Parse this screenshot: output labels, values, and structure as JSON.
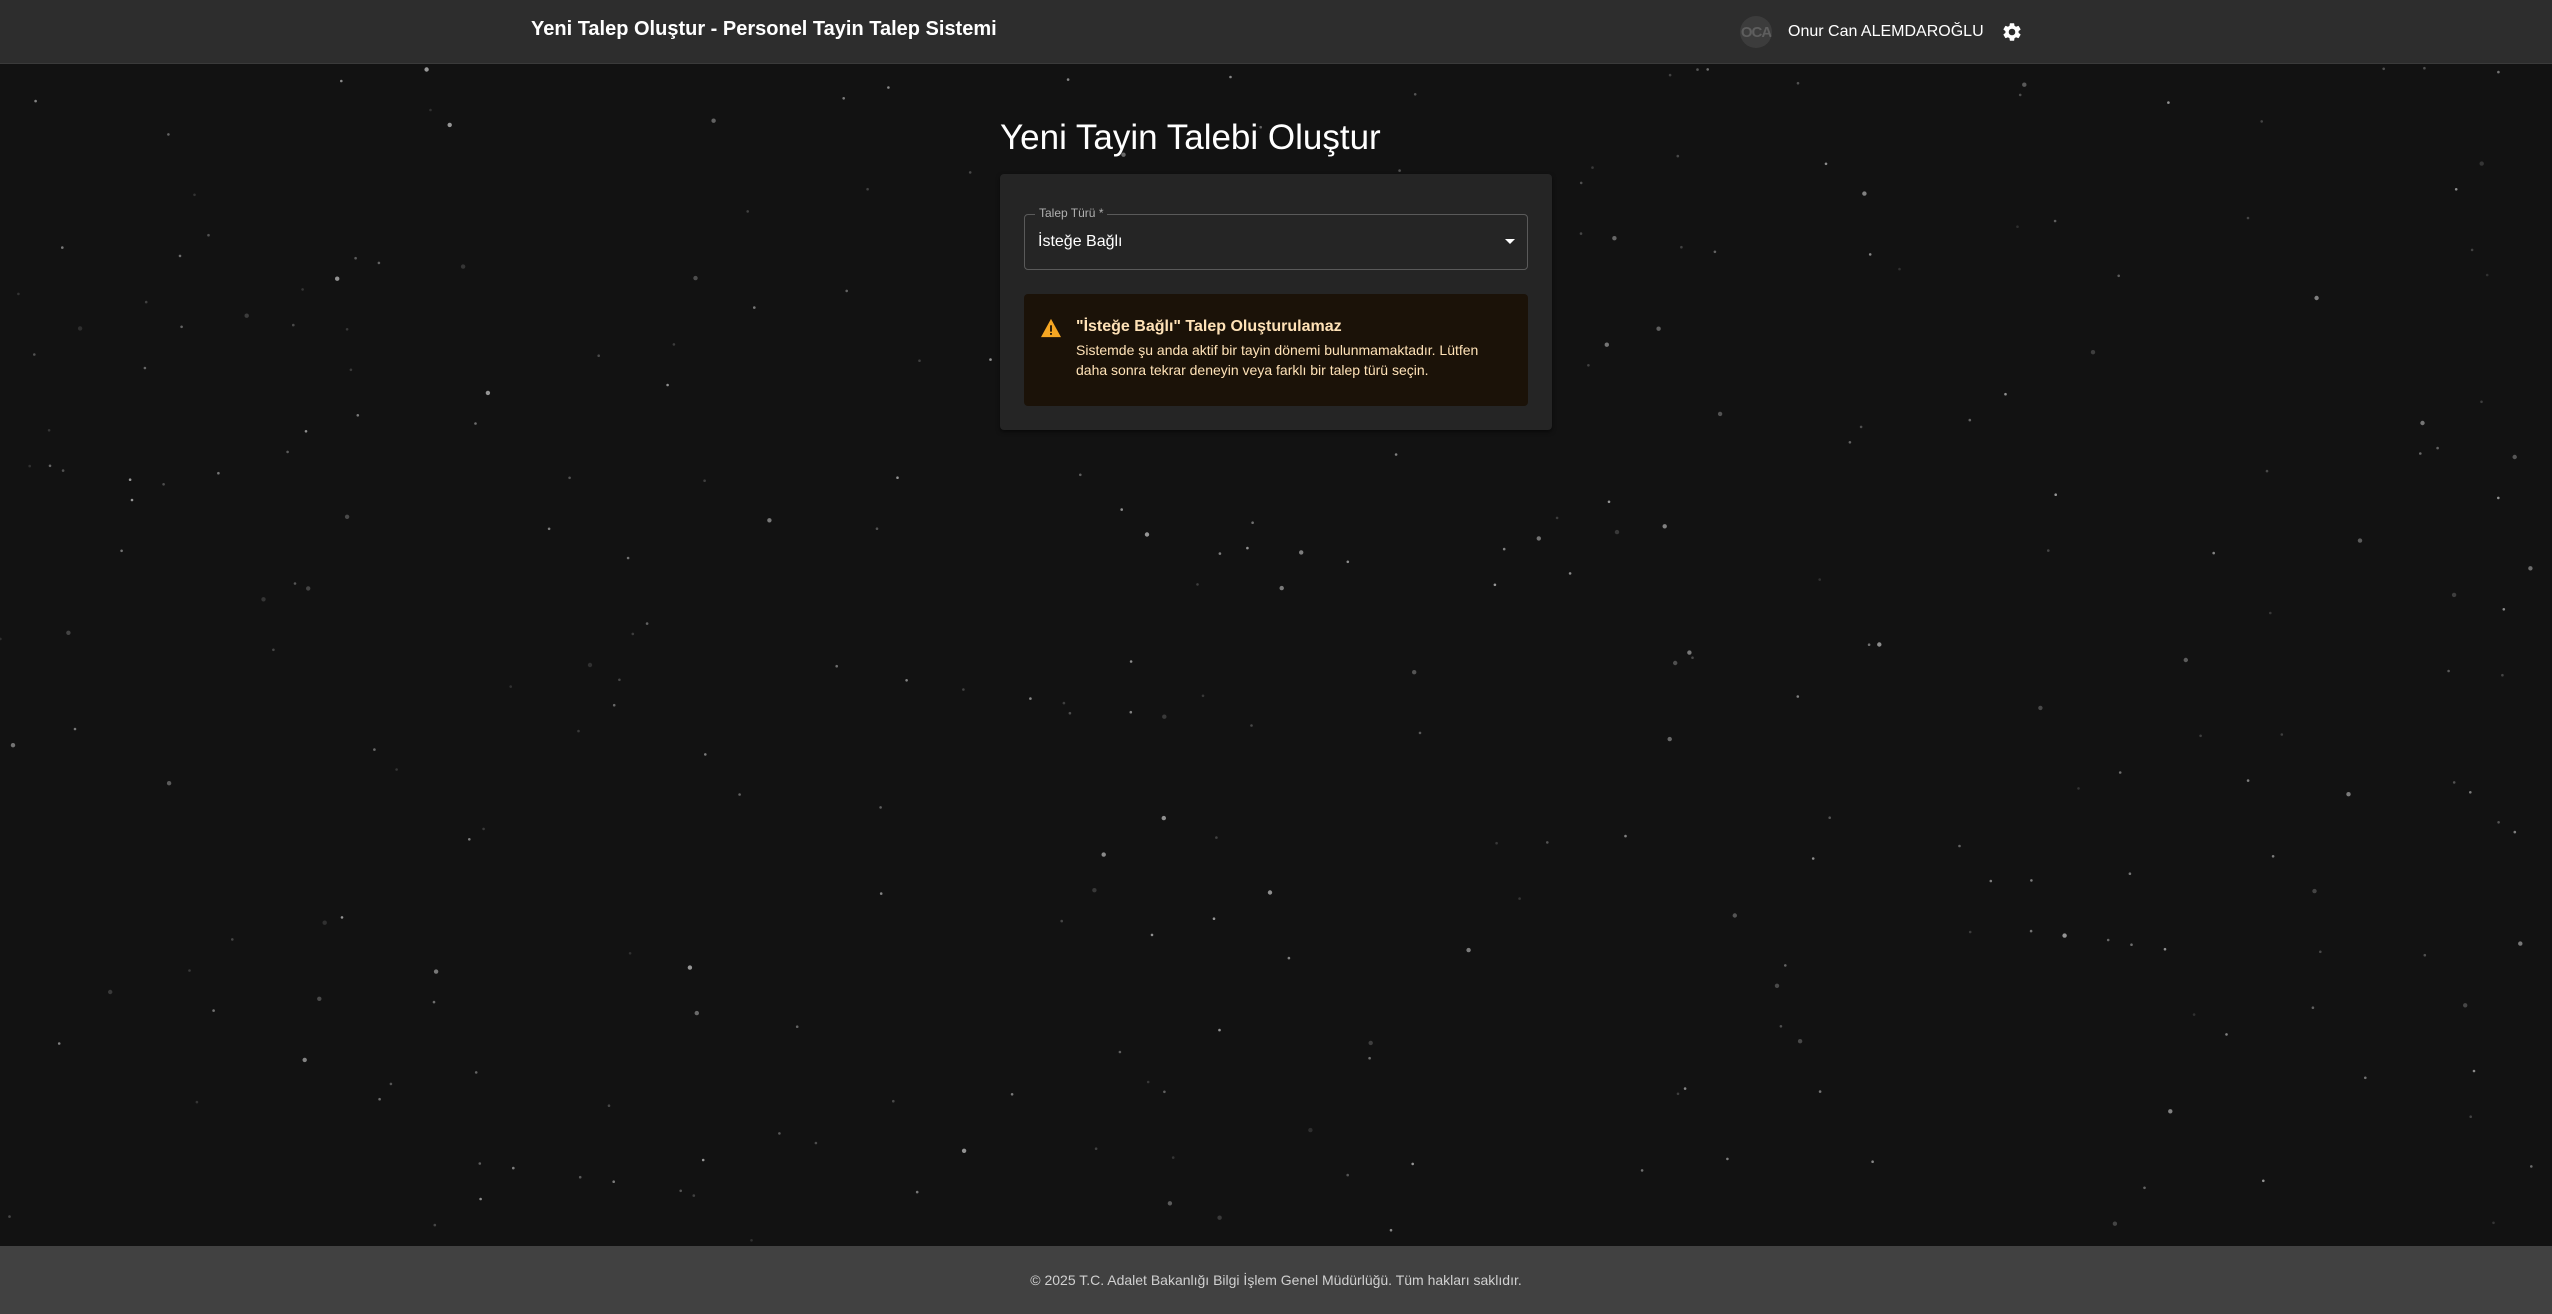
{
  "app_bar": {
    "title": "Yeni Talep Oluştur - Personel Tayin Talep Sistemi",
    "user": {
      "avatar_initials": "OCA",
      "name": "Onur Can ALEMDAROĞLU"
    },
    "settings_icon": "gear-icon"
  },
  "main": {
    "heading": "Yeni Tayin Talebi Oluştur",
    "form": {
      "request_type": {
        "label": "Talep Türü *",
        "value": "İsteğe Bağlı",
        "icon": "dropdown-arrow-icon"
      },
      "alert": {
        "severity": "warning",
        "icon": "warning-triangle-icon",
        "title": "\"İsteğe Bağlı\" Talep Oluşturulamaz",
        "message": "Sistemde şu anda aktif bir tayin dönemi bulunmamaktadır. Lütfen daha sonra tekrar deneyin veya farklı bir talep türü seçin."
      }
    }
  },
  "footer": {
    "text": "© 2025 T.C. Adalet Bakanlığı Bilgi İşlem Genel Müdürlüğü. Tüm hakları saklıdır."
  },
  "colors": {
    "background": "#121212",
    "app_bar": "#2d2d2d",
    "card": "#252525",
    "alert_background": "#1b1208",
    "alert_text": "#ffe2b7",
    "warning_icon": "#f5a623",
    "footer": "#414141"
  }
}
